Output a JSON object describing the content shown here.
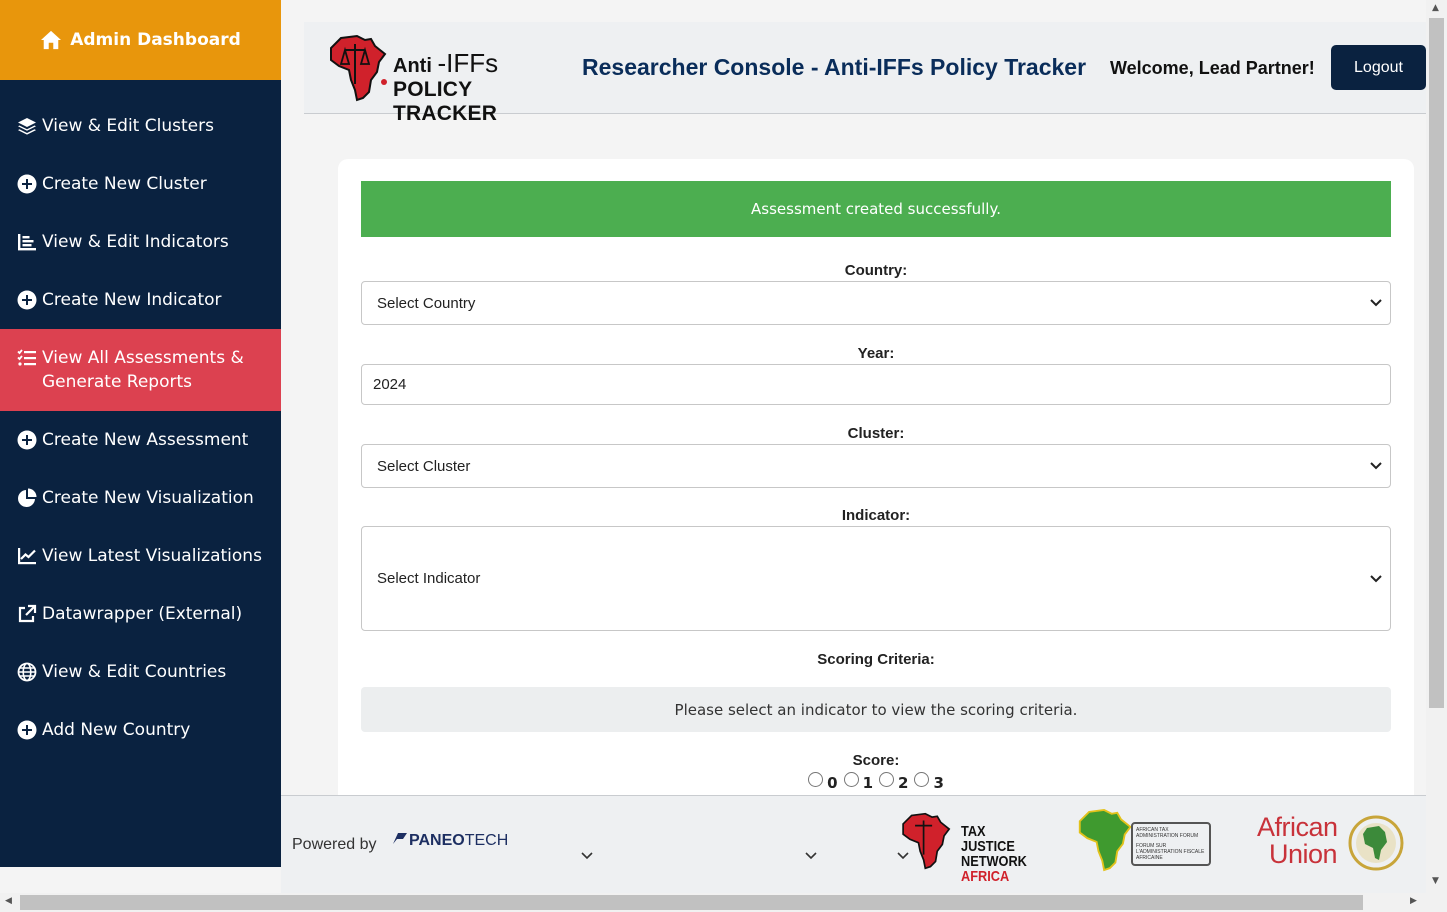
{
  "sidebar": {
    "header": "Admin Dashboard",
    "items": [
      {
        "label": "View & Edit Clusters",
        "icon": "layers-icon"
      },
      {
        "label": "Create New Cluster",
        "icon": "plus-circle-icon"
      },
      {
        "label": "View & Edit Indicators",
        "icon": "list-chart-icon"
      },
      {
        "label": "Create New Indicator",
        "icon": "plus-circle-icon"
      },
      {
        "label": "View All Assessments & Generate Reports",
        "icon": "checklist-icon",
        "active": true
      },
      {
        "label": "Create New Assessment",
        "icon": "plus-circle-icon"
      },
      {
        "label": "Create New Visualization",
        "icon": "pie-chart-icon"
      },
      {
        "label": "View Latest Visualizations",
        "icon": "line-chart-icon"
      },
      {
        "label": "Datawrapper (External)",
        "icon": "external-link-icon"
      },
      {
        "label": "View & Edit Countries",
        "icon": "globe-icon"
      },
      {
        "label": "Add New Country",
        "icon": "plus-circle-icon"
      }
    ]
  },
  "header": {
    "logo_line1_a": "Anti",
    "logo_line1_b": "-IFFs",
    "logo_line2": "POLICY TRACKER",
    "title": "Researcher Console - Anti-IFFs Policy Tracker",
    "welcome": "Welcome, Lead Partner!",
    "logout_label": "Logout"
  },
  "form": {
    "alert": "Assessment created successfully.",
    "country_label": "Country:",
    "country_value": "Select Country",
    "year_label": "Year:",
    "year_value": "2024",
    "cluster_label": "Cluster:",
    "cluster_value": "Select Cluster",
    "indicator_label": "Indicator:",
    "indicator_value": "Select Indicator",
    "criteria_label": "Scoring Criteria:",
    "criteria_text": "Please select an indicator to view the scoring criteria.",
    "score_label": "Score:",
    "score_options": [
      "0",
      "1",
      "2",
      "3"
    ]
  },
  "footer": {
    "powered_by": "Powered by",
    "paneo_a": "PANEO",
    "paneo_b": "TECH",
    "tja_line1": "TAX JUSTICE",
    "tja_line2": "NETWORK",
    "tja_line3": "AFRICA",
    "ataf_line1": "AFRICAN TAX ADMINISTRATION FORUM",
    "ataf_line2": "FORUM SUR L'ADMINISTRATION FISCALE AFRICAINE",
    "au_line1": "African",
    "au_line2": "Union"
  },
  "colors": {
    "sidebar_bg": "#0a2240",
    "header_accent": "#e8960c",
    "active_item": "#dc4150",
    "success": "#4cae50",
    "title": "#0a2d5a"
  }
}
